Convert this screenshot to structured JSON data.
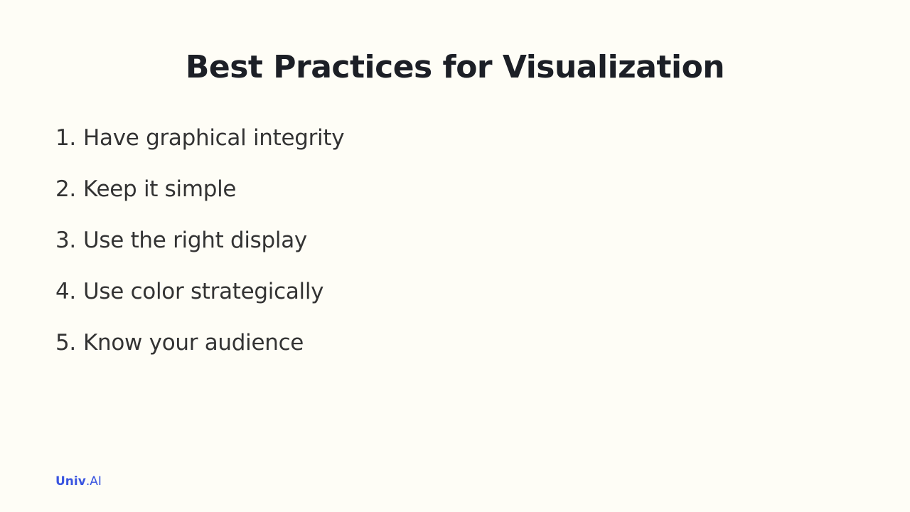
{
  "slide": {
    "title": "Best Practices for Visualization",
    "items": [
      {
        "number": "1.",
        "text": "Have graphical integrity"
      },
      {
        "number": "2.",
        "text": "Keep it simple"
      },
      {
        "number": "3.",
        "text": "Use the right display"
      },
      {
        "number": "4.",
        "text": "Use color strategically"
      },
      {
        "number": "5.",
        "text": "Know your audience"
      }
    ],
    "logo": {
      "part1": "Univ",
      "part2": ".AI"
    }
  },
  "colors": {
    "background": "#fefdf6",
    "title": "#1c1f26",
    "body_text": "#333333",
    "logo": "#3a55e0"
  }
}
